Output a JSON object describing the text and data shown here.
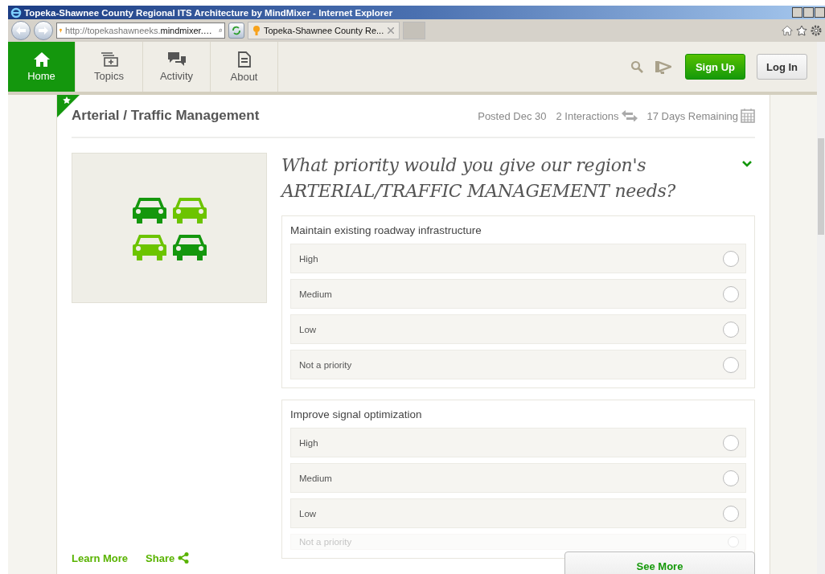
{
  "window": {
    "title": "Topeka-Shawnee County Regional ITS Architecture by MindMixer - Internet Explorer"
  },
  "browser": {
    "address": "http://topekashawneeks.",
    "address_domain": "mindmixer.…",
    "tab": "Topeka-Shawnee County Re..."
  },
  "nav": [
    {
      "label": "Home",
      "selected": true,
      "kind": "home"
    },
    {
      "label": "Topics",
      "selected": false,
      "kind": "topics"
    },
    {
      "label": "Activity",
      "selected": false,
      "kind": "activity"
    },
    {
      "label": "About",
      "selected": false,
      "kind": "about"
    }
  ],
  "buttons": {
    "signup": "Sign Up",
    "login": "Log In"
  },
  "topic": {
    "title": "Arterial / Traffic Management",
    "posted": "Posted Dec 30",
    "interactions": "2 Interactions",
    "remaining": "17 Days Remaining"
  },
  "question": "What priority would you give our region's ARTERIAL/TRAFFIC MANAGEMENT needs?",
  "groups": [
    {
      "label": "Maintain existing roadway infrastructure",
      "options": [
        {
          "label": "High",
          "selected": false
        },
        {
          "label": "Medium",
          "selected": false
        },
        {
          "label": "Low",
          "selected": false
        },
        {
          "label": "Not a priority",
          "selected": false
        }
      ]
    },
    {
      "label": "Improve signal optimization",
      "options": [
        {
          "label": "High",
          "selected": false
        },
        {
          "label": "Medium",
          "selected": false
        },
        {
          "label": "Low",
          "selected": false
        },
        {
          "label": "Not a priority",
          "selected": false
        }
      ]
    }
  ],
  "footer": {
    "learn_more": "Learn More",
    "share": "Share",
    "see_more": "See More"
  }
}
